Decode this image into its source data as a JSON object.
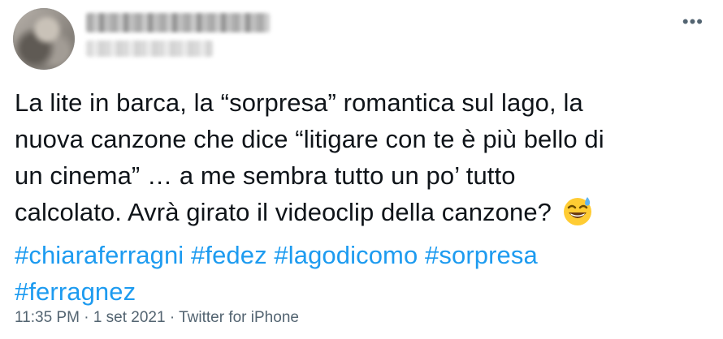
{
  "header": {
    "more_icon": "more-horizontal-icon"
  },
  "tweet": {
    "lines": [
      "La lite in barca, la “sorpresa” romantica sul lago, la",
      "nuova canzone che dice “litigare con te è più bello di",
      "un cinema” … a me sembra tutto un po’ tutto",
      "calcolato. Avrà girato il videoclip della canzone?"
    ],
    "emoji": "grinning-face-with-sweat-icon",
    "hashtags": [
      "#chiaraferragni",
      "#fedez",
      "#lagodicomo",
      "#sorpresa",
      "#ferragnez"
    ]
  },
  "footer": {
    "time": "11:35 PM",
    "separator1": " · ",
    "date": "1 set 2021",
    "separator2": " · ",
    "source": "Twitter for iPhone"
  },
  "colors": {
    "text": "#0f1419",
    "hashtag": "#1d9bf0",
    "secondary": "#536471",
    "background": "#ffffff"
  }
}
